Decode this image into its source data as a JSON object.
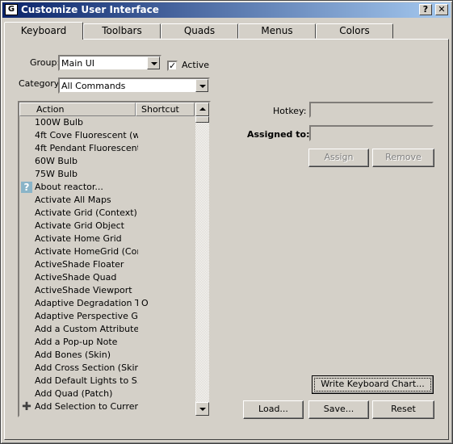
{
  "window": {
    "title": "Customize User Interface",
    "help_label": "?",
    "close_label": "✕",
    "icon_label": "G"
  },
  "tabs": [
    {
      "label": "Keyboard",
      "active": true
    },
    {
      "label": "Toolbars",
      "active": false
    },
    {
      "label": "Quads",
      "active": false
    },
    {
      "label": "Menus",
      "active": false
    },
    {
      "label": "Colors",
      "active": false
    }
  ],
  "group": {
    "label": "Group:",
    "value": "Main UI"
  },
  "active": {
    "label": "Active",
    "checked": true,
    "mark": "✓"
  },
  "category": {
    "label": "Category:",
    "value": "All Commands"
  },
  "actions": {
    "columns": [
      "Action",
      "Shortcut"
    ],
    "rows": [
      {
        "action": "100W Bulb",
        "shortcut": "",
        "icon": ""
      },
      {
        "action": "4ft Cove Fluorescent (w...",
        "shortcut": "",
        "icon": ""
      },
      {
        "action": "4ft Pendant Fluorescent...",
        "shortcut": "",
        "icon": ""
      },
      {
        "action": "60W Bulb",
        "shortcut": "",
        "icon": ""
      },
      {
        "action": "75W Bulb",
        "shortcut": "",
        "icon": ""
      },
      {
        "action": "About reactor...",
        "shortcut": "",
        "icon": "help-icon"
      },
      {
        "action": "Activate All Maps",
        "shortcut": "",
        "icon": ""
      },
      {
        "action": "Activate Grid (Context)",
        "shortcut": "",
        "icon": ""
      },
      {
        "action": "Activate Grid Object",
        "shortcut": "",
        "icon": ""
      },
      {
        "action": "Activate Home Grid",
        "shortcut": "",
        "icon": ""
      },
      {
        "action": "Activate HomeGrid (Con...",
        "shortcut": "",
        "icon": ""
      },
      {
        "action": "ActiveShade Floater",
        "shortcut": "",
        "icon": ""
      },
      {
        "action": "ActiveShade Quad",
        "shortcut": "",
        "icon": ""
      },
      {
        "action": "ActiveShade Viewport",
        "shortcut": "",
        "icon": ""
      },
      {
        "action": "Adaptive Degradation T...",
        "shortcut": "O",
        "icon": ""
      },
      {
        "action": "Adaptive Perspective G...",
        "shortcut": "",
        "icon": ""
      },
      {
        "action": "Add a Custom Attribute...",
        "shortcut": "",
        "icon": ""
      },
      {
        "action": "Add a Pop-up Note",
        "shortcut": "",
        "icon": ""
      },
      {
        "action": "Add Bones (Skin)",
        "shortcut": "",
        "icon": ""
      },
      {
        "action": "Add Cross Section (Skin)",
        "shortcut": "",
        "icon": ""
      },
      {
        "action": "Add Default Lights to S...",
        "shortcut": "",
        "icon": ""
      },
      {
        "action": "Add Quad (Patch)",
        "shortcut": "",
        "icon": ""
      },
      {
        "action": "Add Selection to Curren...",
        "shortcut": "",
        "icon": "add-icon"
      }
    ]
  },
  "hotkey": {
    "label": "Hotkey:",
    "value": ""
  },
  "assigned": {
    "label": "Assigned to:",
    "value": ""
  },
  "buttons": {
    "assign": "Assign",
    "remove": "Remove",
    "write_chart": "Write Keyboard Chart...",
    "load": "Load...",
    "save": "Save...",
    "reset": "Reset"
  }
}
